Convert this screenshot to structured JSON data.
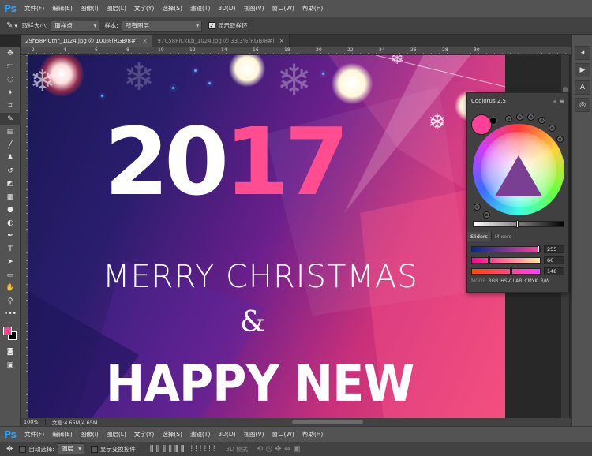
{
  "app": {
    "logo": "Ps"
  },
  "menu": [
    "文件(F)",
    "编辑(E)",
    "图像(I)",
    "图层(L)",
    "文字(Y)",
    "选择(S)",
    "滤镜(T)",
    "3D(D)",
    "视图(V)",
    "窗口(W)",
    "帮助(H)"
  ],
  "options": {
    "sample_size_label": "取样大小:",
    "sample_size_value": "取样点",
    "sample_label": "样本:",
    "sample_value": "所有图层",
    "show_ring_label": "显示取样环"
  },
  "tabs": [
    {
      "label": "29h58PICtnr_1024.jpg @ 100%(RGB/8#)",
      "close": "×"
    },
    {
      "label": "97C58PICkKb_1024.jpg @ 33.3%(RGB/8#)",
      "close": "×"
    }
  ],
  "rulers": [
    "2",
    "4",
    "6",
    "8",
    "10",
    "12",
    "14",
    "16",
    "18",
    "20",
    "22",
    "24",
    "26",
    "28",
    "30"
  ],
  "poster": {
    "year_white": "20",
    "year_pink": "17",
    "merry": "MERRY CHRISTMAS",
    "amp": "&",
    "happy": "HAPPY NEW"
  },
  "status": {
    "zoom": "100%",
    "doc": "文档:4.65M/4.65M"
  },
  "panel": {
    "title": "Coolorus 2.5",
    "tabs": [
      "Sliders",
      "Mixers"
    ],
    "sliders": [
      {
        "value": "255",
        "fill": 0.99
      },
      {
        "value": "66",
        "fill": 0.26
      },
      {
        "value": "148",
        "fill": 0.58
      }
    ],
    "mode_label": "MODE",
    "modes": [
      "RGB",
      "HSV",
      "LAB",
      "CMYK",
      "B/W"
    ],
    "current_color": "#ff4296"
  },
  "options2": {
    "auto_select_label": "自动选择:",
    "auto_select_value": "图层",
    "show_transform_label": "显示变换控件",
    "mode_3d_label": "3D 模式:"
  },
  "colors": {
    "accent": "#31a8ff",
    "pink": "#ff4296"
  },
  "tools": [
    "move-tool",
    "marquee-tool",
    "lasso-tool",
    "quick-select-tool",
    "crop-tool",
    "eyedropper-tool",
    "healing-tool",
    "brush-tool",
    "clone-tool",
    "history-brush-tool",
    "eraser-tool",
    "gradient-tool",
    "blur-tool",
    "dodge-tool",
    "pen-tool",
    "type-tool",
    "path-select-tool",
    "shape-tool",
    "hand-tool",
    "zoom-tool",
    "more-tool"
  ]
}
